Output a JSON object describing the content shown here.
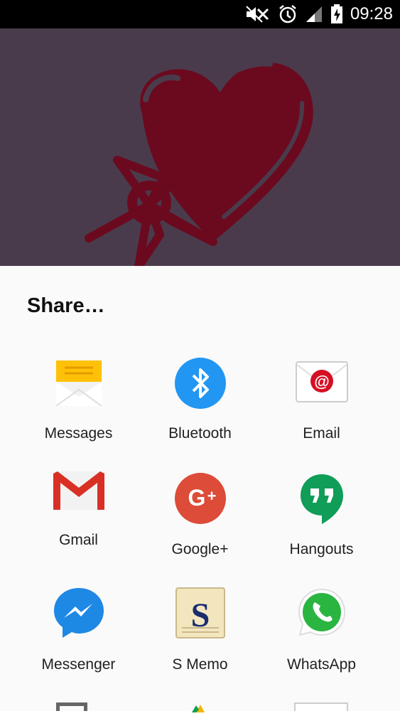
{
  "status_bar": {
    "time": "09:28",
    "icons": [
      "mute-icon",
      "alarm-icon",
      "signal-icon",
      "battery-icon"
    ]
  },
  "share_sheet": {
    "title": "Share…",
    "apps": [
      {
        "label": "Messages",
        "icon": "messages-icon"
      },
      {
        "label": "Bluetooth",
        "icon": "bluetooth-icon"
      },
      {
        "label": "Email",
        "icon": "email-icon"
      },
      {
        "label": "Gmail",
        "icon": "gmail-icon"
      },
      {
        "label": "Google+",
        "icon": "google-plus-icon"
      },
      {
        "label": "Hangouts",
        "icon": "hangouts-icon"
      },
      {
        "label": "Messenger",
        "icon": "messenger-icon"
      },
      {
        "label": "S Memo",
        "icon": "s-memo-icon"
      },
      {
        "label": "WhatsApp",
        "icon": "whatsapp-icon"
      }
    ]
  },
  "colors": {
    "background_dim": "#4a3b4c",
    "heart": "#6b0a1f",
    "sheet": "#fafafa"
  }
}
